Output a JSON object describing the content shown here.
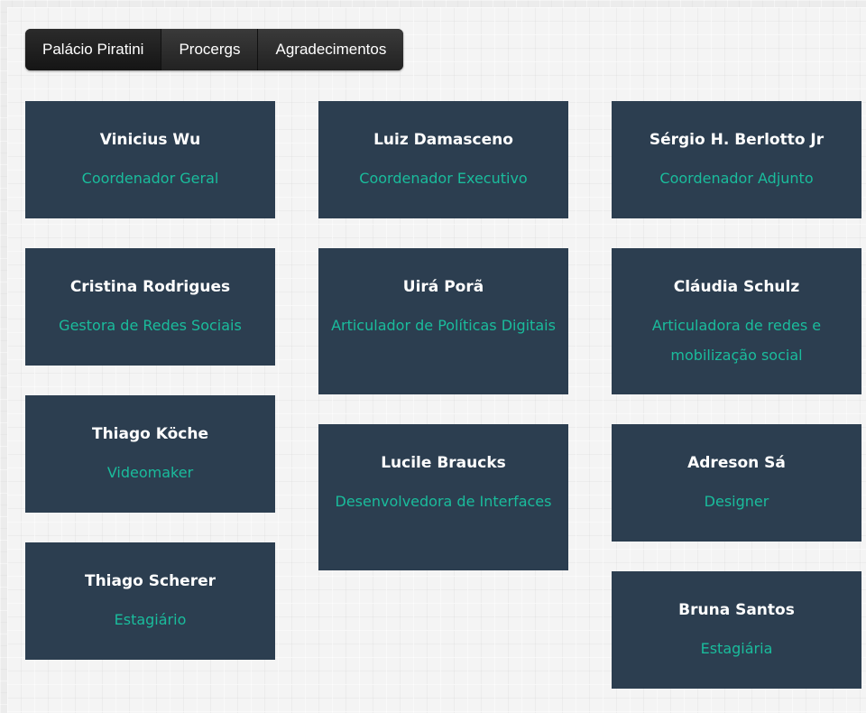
{
  "tabs": [
    {
      "label": "Palácio Piratini"
    },
    {
      "label": "Procergs"
    },
    {
      "label": "Agradecimentos"
    }
  ],
  "colors": {
    "card_bg": "#2c3e50",
    "name_text": "#ffffff",
    "role_text": "#1abc9c",
    "tab_bg": "#222222"
  },
  "team": [
    {
      "name": "Vinicius Wu",
      "role": "Coordenador Geral"
    },
    {
      "name": "Luiz Damasceno",
      "role": "Coordenador Executivo"
    },
    {
      "name": "Sérgio H. Berlotto Jr",
      "role": "Coordenador Adjunto"
    },
    {
      "name": "Cristina Rodrigues",
      "role": "Gestora de Redes Sociais"
    },
    {
      "name": "Uirá Porã",
      "role": "Articulador de Políticas Digitais"
    },
    {
      "name": "Cláudia Schulz",
      "role": "Articuladora de redes e mobilização social"
    },
    {
      "name": "Thiago Köche",
      "role": "Videomaker"
    },
    {
      "name": "Lucile Braucks",
      "role": "Desenvolvedora de Interfaces"
    },
    {
      "name": "Adreson Sá",
      "role": "Designer"
    },
    {
      "name": "Thiago Scherer",
      "role": "Estagiário"
    },
    {
      "name": "Bruna Santos",
      "role": "Estagiária"
    }
  ]
}
